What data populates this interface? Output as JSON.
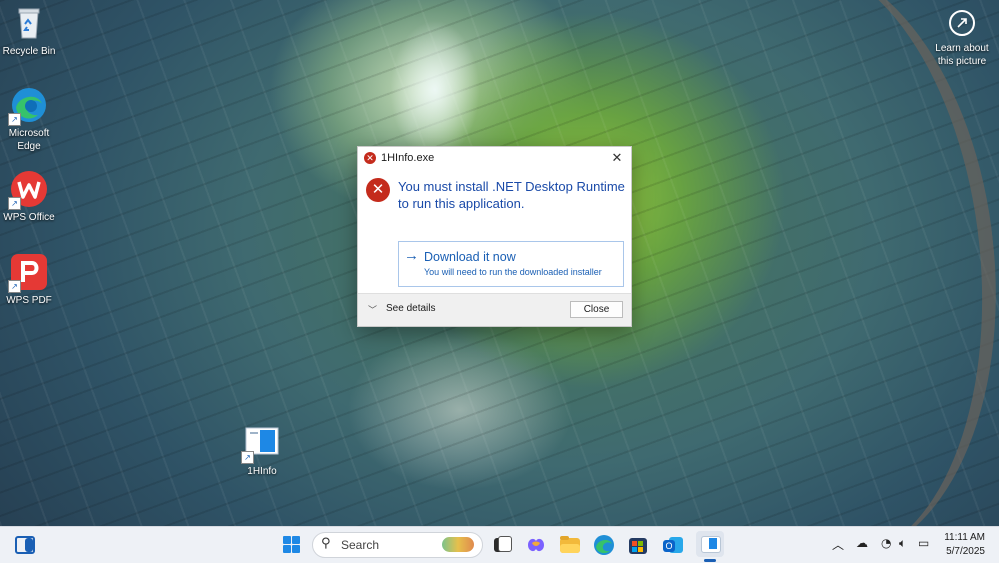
{
  "desktop": {
    "icons": [
      {
        "label": "Recycle Bin"
      },
      {
        "label": "Microsoft\nEdge"
      },
      {
        "label": "WPS Office"
      },
      {
        "label": "WPS PDF"
      },
      {
        "label": "1HInfo"
      }
    ],
    "learn": {
      "label": "Learn about\nthis picture"
    }
  },
  "dialog": {
    "title": "1HInfo.exe",
    "message": "You must install .NET Desktop Runtime to run this application.",
    "command": {
      "title": "Download it now",
      "note": "You will need to run the downloaded installer"
    },
    "details_label": "See details",
    "close_label": "Close"
  },
  "taskbar": {
    "search_placeholder": "Search",
    "time": "11:11 AM",
    "date": "5/7/2025",
    "icons": [
      "widgets-icon",
      "start-icon",
      "task-view-icon",
      "copilot-icon",
      "file-explorer-icon",
      "edge-icon",
      "store-icon",
      "outlook-icon",
      "1hinfo-app-icon"
    ],
    "tray_icons": [
      "chevron-up-icon",
      "onedrive-icon",
      "wifi-icon",
      "volume-icon",
      "battery-icon"
    ]
  },
  "colors": {
    "accent": "#1a5fb4",
    "error": "#c42b1c",
    "message_text": "#1a4aa8"
  }
}
